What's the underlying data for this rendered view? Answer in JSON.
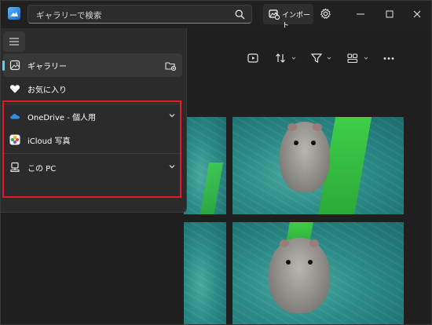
{
  "search": {
    "placeholder": "ギャラリーで検索"
  },
  "toolbar": {
    "import_label": "インポート"
  },
  "sidebar": {
    "items": [
      {
        "label": "ギャラリー",
        "icon": "gallery-icon",
        "selected": true,
        "action_icon": "add-folder-icon"
      },
      {
        "label": "お気に入り",
        "icon": "heart-icon"
      },
      {
        "label": "OneDrive - 個人用",
        "icon": "onedrive-cloud-icon",
        "expandable": true
      },
      {
        "label": "iCloud 写真",
        "icon": "icloud-photos-icon"
      },
      {
        "label": "この PC",
        "icon": "pc-icon",
        "expandable": true
      }
    ]
  },
  "colors": {
    "accent": "#60cdff",
    "highlight_frame": "#e01b2a",
    "background": "#1f1f1f"
  }
}
